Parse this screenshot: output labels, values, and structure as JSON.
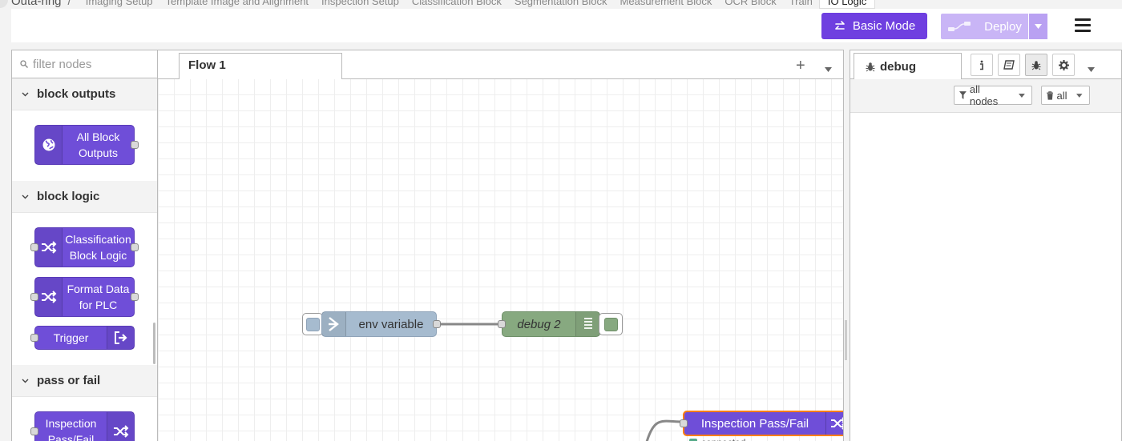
{
  "breadcrumb": {
    "root": "Outa-ring",
    "separator": "/",
    "tabs": [
      "Imaging Setup",
      "Template Image and Alignment",
      "Inspection Setup",
      "Classification Block",
      "Segmentation Block",
      "Measurement Block",
      "OCR Block",
      "Train",
      "IO Logic"
    ],
    "active_index": 8
  },
  "header": {
    "basic_mode_label": "Basic Mode",
    "deploy_label": "Deploy"
  },
  "palette": {
    "filter_placeholder": "filter nodes",
    "categories": [
      {
        "label": "block outputs",
        "nodes": [
          {
            "label_line1": "All Block",
            "label_line2": "Outputs"
          }
        ]
      },
      {
        "label": "block logic",
        "nodes": [
          {
            "label_line1": "Classification",
            "label_line2": "Block Logic"
          },
          {
            "label_line1": "Format Data",
            "label_line2": "for PLC"
          },
          {
            "label": "Trigger"
          }
        ]
      },
      {
        "label": "pass or fail",
        "nodes": [
          {
            "label_line1": "Inspection",
            "label_line2": "Pass/Fail"
          }
        ]
      }
    ]
  },
  "workspace": {
    "tab_label": "Flow 1",
    "add_symbol": "+",
    "nodes": {
      "env": {
        "label": "env variable"
      },
      "debug": {
        "label": "debug 2"
      },
      "inspection": {
        "label": "Inspection Pass/Fail",
        "status": "connected"
      }
    }
  },
  "sidebar": {
    "tab_label": "debug",
    "filter_nodes_label": "all nodes",
    "clear_label": "all"
  },
  "colors": {
    "accent": "#6f3fe0",
    "deploy_disabled": "#c9b5f6",
    "node_purple": "#6f4ed8",
    "env_node": "#a6bbcf",
    "debug_node": "#87a980",
    "selected_border": "#ff7f0e"
  }
}
